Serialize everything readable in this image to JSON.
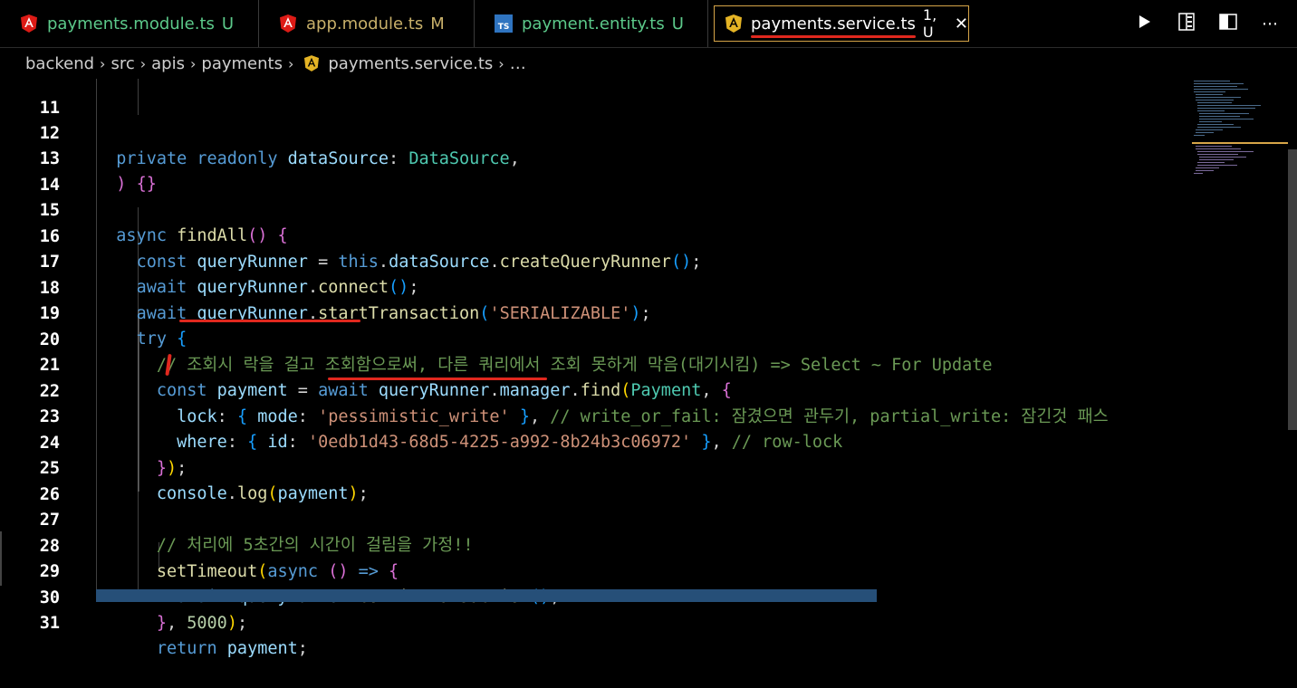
{
  "tabs": [
    {
      "name": "payments.module.ts",
      "status": "U",
      "icon": "angular-icon"
    },
    {
      "name": "app.module.ts",
      "status": "M",
      "icon": "angular-icon"
    },
    {
      "name": "payment.entity.ts",
      "status": "U",
      "icon": "typescript-icon"
    },
    {
      "name": "payments.service.ts",
      "status": "1, U",
      "icon": "angular-yellow-icon",
      "active": true
    }
  ],
  "actions": [
    {
      "icon": "run-icon"
    },
    {
      "icon": "open-changes-icon"
    },
    {
      "icon": "split-editor-icon"
    },
    {
      "icon": "more-icon",
      "glyph": "⋯"
    }
  ],
  "breadcrumb": {
    "items": [
      "backend",
      "src",
      "apis",
      "payments",
      "payments.service.ts",
      "…"
    ],
    "separator": "›"
  },
  "editor": {
    "line_numbers": [
      "11",
      "12",
      "13",
      "14",
      "15",
      "16",
      "17",
      "18",
      "19",
      "20",
      "21",
      "22",
      "23",
      "24",
      "25",
      "26",
      "27",
      "28",
      "29",
      "30",
      "31"
    ],
    "l12": {
      "a": "private",
      "b": "readonly",
      "c": "dataSource",
      "d": ": ",
      "e": "DataSource",
      "f": ","
    },
    "l13": {
      "a": ")",
      "b": "{}"
    },
    "l15": {
      "a": "async",
      "b": "findAll",
      "c": "()",
      "d": "{"
    },
    "l16": {
      "a": "const",
      "b": "queryRunner",
      "c": " = ",
      "d": "this",
      "e": ".",
      "f": "dataSource",
      "g": ".",
      "h": "createQueryRunner",
      "i": "()",
      "j": ";"
    },
    "l17": {
      "a": "await",
      "b": "queryRunner",
      "c": ".",
      "d": "connect",
      "e": "()",
      "f": ";"
    },
    "l18": {
      "a": "await",
      "b": "queryRunner",
      "c": ".",
      "d": "startTransaction",
      "e": "(",
      "f": "'SERIALIZABLE'",
      "g": ")",
      "h": ";"
    },
    "l19": {
      "a": "try",
      "b": "{"
    },
    "l20": {
      "a": "// 조회시 락을 걸고 조회함으로써, 다른 쿼리에서 조회 못하게 막음(대기시킴) => Select ~ For Update"
    },
    "l21": {
      "a": "const",
      "b": "payment",
      "c": " = ",
      "d": "await",
      "e": "queryRunner",
      "f": ".",
      "g": "manager",
      "h": ".",
      "i": "find",
      "j": "(",
      "k": "Payment",
      "l": ", ",
      "m": "{"
    },
    "l22": {
      "a": "lock",
      "b": ": ",
      "c": "{",
      "d": "mode",
      "e": ": ",
      "f": "'pessimistic_write'",
      "g": " ",
      "h": "}",
      "i": ", ",
      "j": "// write_or_fail: 잠겼으면 관두기, partial_write: 잠긴것 패스"
    },
    "l23": {
      "a": "where",
      "b": ": ",
      "c": "{",
      "d": "id",
      "e": ": ",
      "f": "'0edb1d43-68d5-4225-a992-8b24b3c06972'",
      "g": " ",
      "h": "}",
      "i": ", ",
      "j": "// row-lock"
    },
    "l24": {
      "a": "}",
      "b": ")",
      "c": ";"
    },
    "l25": {
      "a": "console",
      "b": ".",
      "c": "log",
      "d": "(",
      "e": "payment",
      "f": ")",
      "g": ";"
    },
    "l27": {
      "a": "// 처리에 5초간의 시간이 걸림을 가정!!"
    },
    "l28": {
      "a": "setTimeout",
      "b": "(",
      "c": "async",
      "d": " ",
      "e": "()",
      "f": " => ",
      "g": "{"
    },
    "l29": {
      "a": "await",
      "b": "queryRunner",
      "c": ".",
      "d": "commitTransaction",
      "e": "()",
      "f": ";"
    },
    "l30": {
      "a": "}",
      "b": ", ",
      "c": "5000",
      "d": ")",
      "e": ";"
    },
    "l31": {
      "a": "return",
      "b": "payment",
      "c": ";"
    }
  },
  "colors": {
    "accent_border": "#d7a548",
    "annotation": "#e0281e",
    "untracked": "#5cc98a",
    "modified": "#c8b06a"
  }
}
